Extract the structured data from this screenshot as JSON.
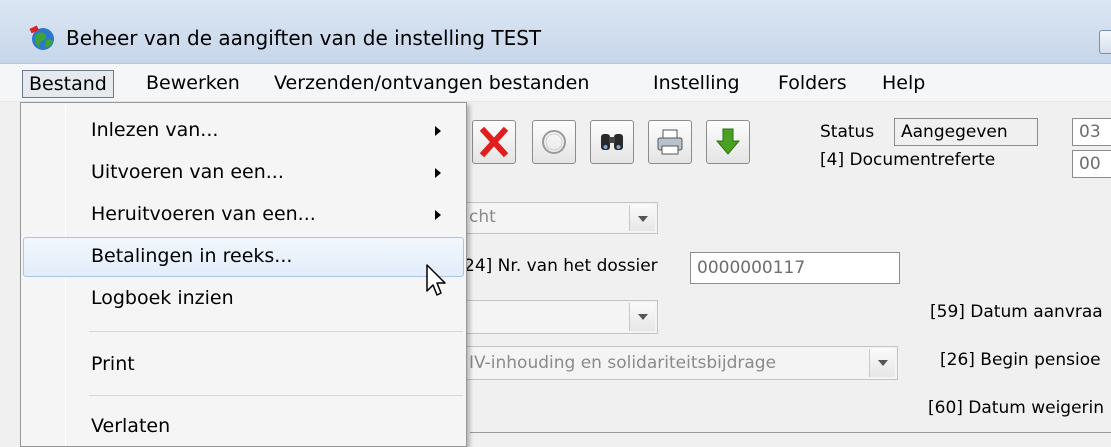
{
  "window": {
    "title": "Beheer van de aangiften van de instelling TEST"
  },
  "menubar": {
    "items": [
      "Bestand",
      "Bewerken",
      "Verzenden/ontvangen bestanden",
      "Instelling",
      "Folders",
      "Help"
    ]
  },
  "file_menu": {
    "items": [
      {
        "label": "Inlezen van...",
        "submenu": true
      },
      {
        "label": "Uitvoeren van een...",
        "submenu": true
      },
      {
        "label": "Heruitvoeren van een...",
        "submenu": true
      },
      {
        "label": "Betalingen in reeks...",
        "submenu": false,
        "highlighted": true
      },
      {
        "label": "Logboek inzien",
        "submenu": false
      },
      {
        "label": "Print",
        "submenu": false
      },
      {
        "label": "Verlaten",
        "submenu": false
      }
    ]
  },
  "form": {
    "status_label": "Status",
    "status_value": "Aangegeven",
    "status_right_value": "03",
    "docref_label": "[4] Documentreferte",
    "docref_right_value": "00",
    "combo1_value": "cht",
    "dossier_label": "24] Nr. van het dossier",
    "dossier_value": "0000000117",
    "datum_aanvraag_label": "[59] Datum aanvraa",
    "combo3_value": "IV-inhouding en solidariteitsbijdrage",
    "begin_pensioen_label": "[26] Begin pensioe",
    "datum_weigering_label": "[60] Datum weigerin"
  },
  "colors": {
    "delete_red": "#e01e1e",
    "download_green": "#4aa020",
    "hover_border": "#a9c6e8"
  }
}
